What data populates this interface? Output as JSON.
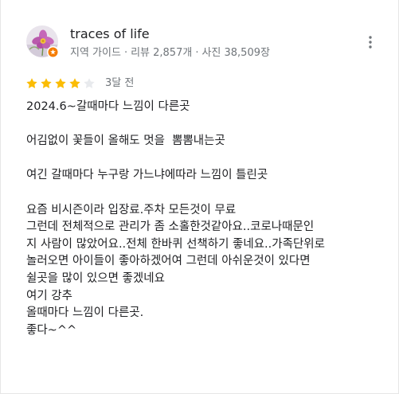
{
  "reviewer": {
    "name": "traces of life",
    "role": "지역 가이드",
    "reviews": "리뷰 2,857개",
    "photos": "사진 38,509장",
    "separator": "·"
  },
  "rating": {
    "stars": 4,
    "max": 5,
    "filled_color": "#fbbc04",
    "empty_color": "#e8eaed"
  },
  "date": "3달 전",
  "review_lines": [
    "2024.6~갈때마다 느낌이 다른곳",
    "",
    "어김없이 꽃들이 올해도 멋을  뽐뽐내는곳",
    "",
    "여긴 갈때마다 누구랑 가느냐에따라 느낌이 틀린곳",
    "",
    "요즘 비시즌이라 입장료.주차 모든것이 무료",
    "그런데 전체적으로 관리가 좀 소홀한것같아요..코로나때문인",
    "지 사람이 많았어요..전체 한바퀴 선책하기 좋네요..가족단위로",
    "놀러오면 아이들이 좋아하겠어여 그런데 아쉬운것이 있다면",
    "쉴곳을 많이 있으면 좋겠네요",
    "여기 강추",
    "올때마다 느낌이 다른곳.",
    "좋다~^^"
  ],
  "icons": {
    "avatar": "cosmos-flower-avatar",
    "badge": "local-guide-badge-icon",
    "more": "more-vert-icon",
    "star": "star-icon"
  }
}
